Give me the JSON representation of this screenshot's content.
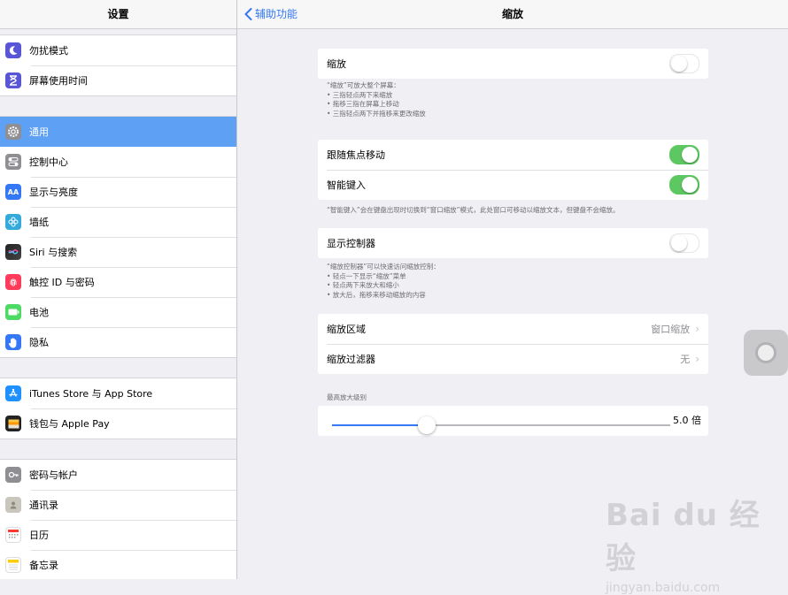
{
  "sidebar": {
    "title": "设置",
    "groups": [
      [
        {
          "label": "勿扰模式",
          "icon": "moon-icon",
          "color": "#5856d6"
        },
        {
          "label": "屏幕使用时间",
          "icon": "hourglass-icon",
          "color": "#5856d6"
        }
      ],
      [
        {
          "label": "通用",
          "icon": "gear-icon",
          "color": "#8e8e93",
          "selected": true
        },
        {
          "label": "控制中心",
          "icon": "switches-icon",
          "color": "#8e8e93"
        },
        {
          "label": "显示与亮度",
          "icon": "text-size-icon",
          "color": "#3478f6"
        },
        {
          "label": "墙纸",
          "icon": "flower-icon",
          "color": "#34aadc"
        },
        {
          "label": "Siri 与搜索",
          "icon": "siri-icon",
          "color": "#222222"
        },
        {
          "label": "触控 ID 与密码",
          "icon": "fingerprint-icon",
          "color": "#ff3b5c"
        },
        {
          "label": "电池",
          "icon": "battery-icon",
          "color": "#4cd964"
        },
        {
          "label": "隐私",
          "icon": "hand-icon",
          "color": "#3478f6"
        }
      ],
      [
        {
          "label": "iTunes Store 与 App Store",
          "icon": "app-store-icon",
          "color": "#1e90ff"
        },
        {
          "label": "钱包与 Apple Pay",
          "icon": "wallet-icon",
          "color": "#222222"
        }
      ],
      [
        {
          "label": "密码与帐户",
          "icon": "key-icon",
          "color": "#8e8e93"
        },
        {
          "label": "通讯录",
          "icon": "contacts-icon",
          "color": "#b5b3a8"
        },
        {
          "label": "日历",
          "icon": "calendar-icon",
          "color": "#ffffff"
        },
        {
          "label": "备忘录",
          "icon": "notes-icon",
          "color": "#ffffff"
        }
      ]
    ]
  },
  "nav": {
    "back_label": "辅助功能",
    "title": "缩放"
  },
  "zoom": {
    "label": "缩放",
    "enabled": false,
    "note_lines": [
      "“缩放”可放大整个屏幕：",
      "• 三指轻点两下来缩放",
      "• 拖移三指在屏幕上移动",
      "• 三指轻点两下并拖移来更改缩放"
    ]
  },
  "follow_focus": {
    "label": "跟随焦点移动",
    "enabled": true
  },
  "smart_typing": {
    "label": "智能键入",
    "enabled": true,
    "note": "“智能键入”会在键盘出现时切换到“窗口缩放”模式，此处窗口可移动以缩放文本，但键盘不会缩放。"
  },
  "show_controller": {
    "label": "显示控制器",
    "enabled": false,
    "note_lines": [
      "“缩放控制器”可以快速访问缩放控制：",
      "• 轻点一下显示“缩放”菜单",
      "• 轻点两下来放大和缩小",
      "• 放大后，拖移来移动缩放的内容"
    ]
  },
  "zoom_region": {
    "label": "缩放区域",
    "value": "窗口缩放"
  },
  "zoom_filter": {
    "label": "缩放过滤器",
    "value": "无"
  },
  "max_zoom": {
    "section_label": "最高放大级别",
    "value_label": "5.0 倍",
    "fraction": 0.28
  },
  "watermark": {
    "main": "Bai du 经验",
    "sub": "jingyan.baidu.com"
  }
}
